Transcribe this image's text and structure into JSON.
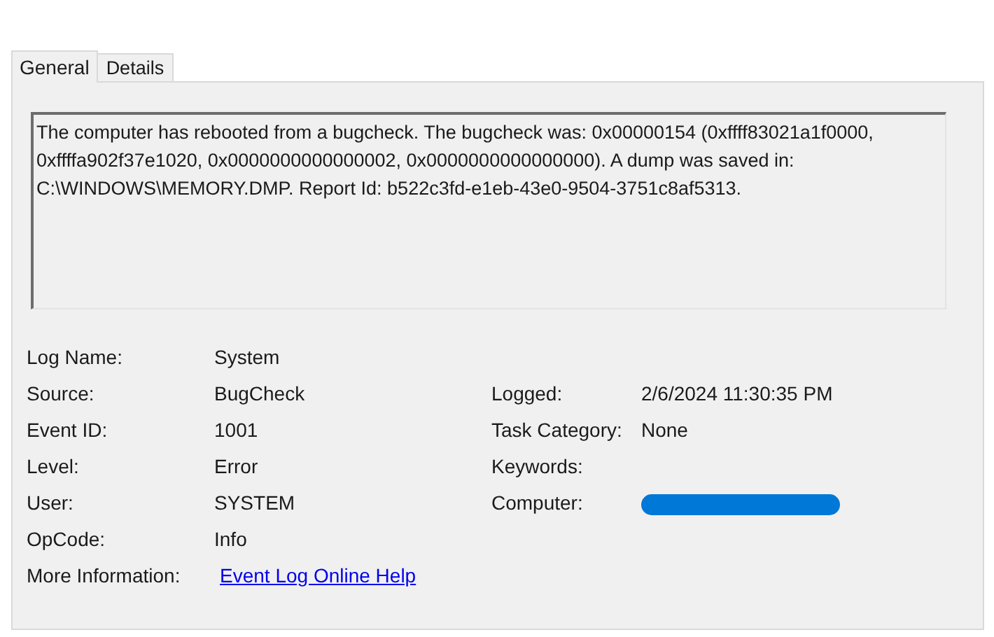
{
  "tabs": [
    {
      "label": "General",
      "selected": true
    },
    {
      "label": "Details",
      "selected": false
    }
  ],
  "description": "The computer has rebooted from a bugcheck.  The bugcheck was: 0x00000154 (0xffff83021a1f0000, 0xffffa902f37e1020, 0x0000000000000002, 0x0000000000000000). A dump was saved in: C:\\WINDOWS\\MEMORY.DMP. Report Id: b522c3fd-e1eb-43e0-9504-3751c8af5313.",
  "rows": [
    {
      "left": {
        "label": "Log Name:",
        "value": "System",
        "kind": "text"
      }
    },
    {
      "left": {
        "label": "Source:",
        "value": "BugCheck",
        "kind": "text"
      },
      "right": {
        "label": "Logged:",
        "value": "2/6/2024 11:30:35 PM",
        "kind": "text"
      }
    },
    {
      "left": {
        "label": "Event ID:",
        "value": "1001",
        "kind": "text"
      },
      "right": {
        "label": "Task Category:",
        "value": "None",
        "kind": "text"
      }
    },
    {
      "left": {
        "label": "Level:",
        "value": "Error",
        "kind": "text"
      },
      "right": {
        "label": "Keywords:",
        "kind": "empty"
      }
    },
    {
      "left": {
        "label": "User:",
        "value": "SYSTEM",
        "kind": "text"
      },
      "right": {
        "label": "Computer:",
        "kind": "redacted"
      }
    },
    {
      "left": {
        "label": "OpCode:",
        "value": "Info",
        "kind": "text"
      }
    },
    {
      "left": {
        "label": "More Information:",
        "value": "Event Log Online Help",
        "kind": "link"
      }
    }
  ]
}
